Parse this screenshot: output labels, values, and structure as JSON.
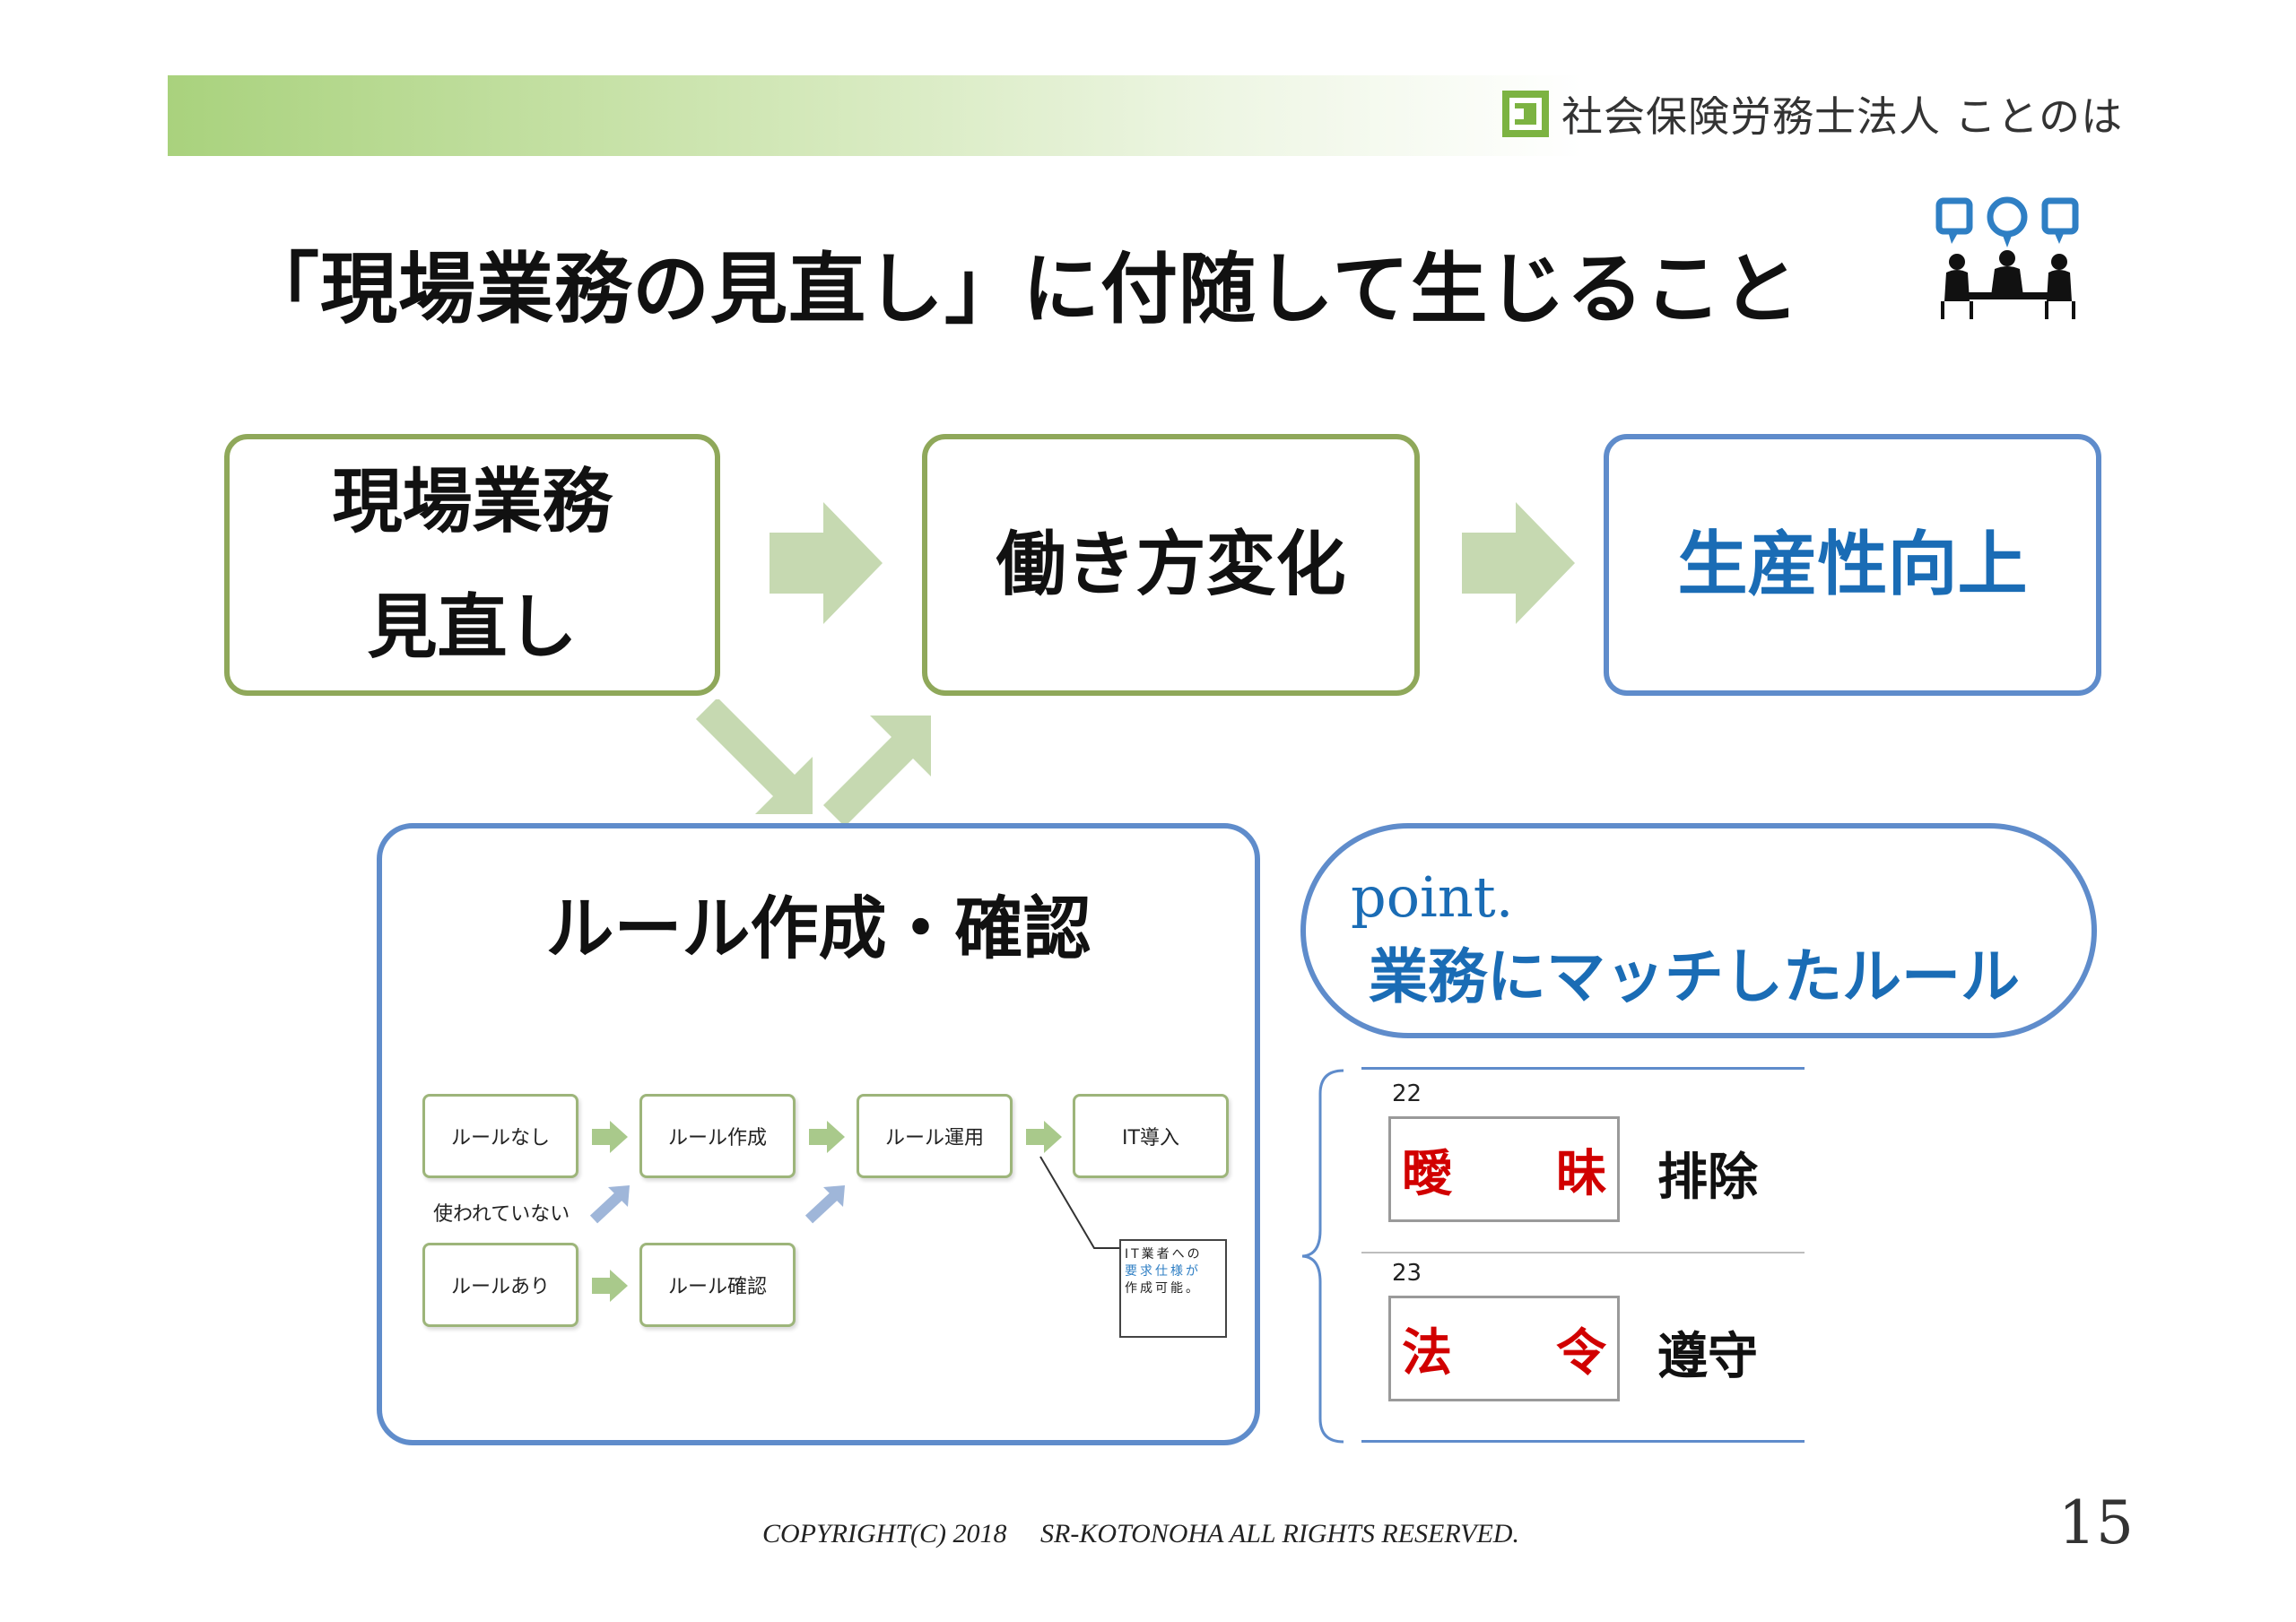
{
  "header": {
    "brand_name": "社会保険労務士法人 ことのは",
    "logo_icon": "kotonoha-logo-icon",
    "accent_green": "#a9d27d"
  },
  "title": "「現場業務の見直し」に付随して生じること",
  "meeting_icon": "meeting-people-icon",
  "flow": {
    "step1_line1": "現場業務",
    "step1_line2": "見直し",
    "step2": "働き方変化",
    "step3": "生産性向上"
  },
  "rule_box": {
    "title": "ルール作成・確認",
    "mini": {
      "rule_none": "ルールなし",
      "rule_create": "ルール作成",
      "rule_operate": "ルール運用",
      "it_intro": "IT導入",
      "unused_label": "使われていない",
      "rule_exists": "ルールあり",
      "rule_confirm": "ルール確認",
      "it_note_line1": "IT業者への",
      "it_note_line2": "要求仕様が",
      "it_note_line3": "作成可能。"
    }
  },
  "point": {
    "label": "point.",
    "text": "業務にマッチしたルール"
  },
  "terms": [
    {
      "num": "22",
      "char1": "曖",
      "char2": "昧",
      "action": "排除"
    },
    {
      "num": "23",
      "char1": "法",
      "char2": "令",
      "action": "遵守"
    }
  ],
  "footer": {
    "copyright": "COPYRIGHT(C) 2018　 SR-KOTONOHA ALL RIGHTS RESERVED.",
    "page_number": "15"
  }
}
